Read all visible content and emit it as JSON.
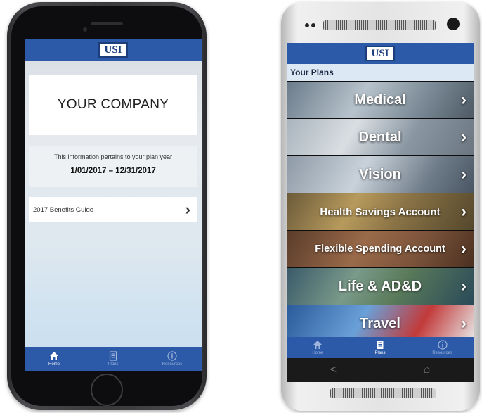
{
  "left_phone": {
    "logo": "USI",
    "company": "YOUR COMPANY",
    "plan_info": "This information pertains to your plan year",
    "plan_dates": "1/01/2017 – 12/31/2017",
    "guide_label": "2017 Benefits Guide",
    "tabs": [
      {
        "label": "Home",
        "icon": "home-icon",
        "active": true
      },
      {
        "label": "Plans",
        "icon": "document-icon",
        "active": false
      },
      {
        "label": "Resources",
        "icon": "info-icon",
        "active": false
      }
    ]
  },
  "right_phone": {
    "logo": "USI",
    "header": "Your Plans",
    "plans": [
      {
        "label": "Medical"
      },
      {
        "label": "Dental"
      },
      {
        "label": "Vision"
      },
      {
        "label": "Health Savings Account"
      },
      {
        "label": "Flexible Spending Account"
      },
      {
        "label": "Life & AD&D"
      },
      {
        "label": "Travel"
      }
    ],
    "tabs": [
      {
        "label": "Home",
        "icon": "home-icon",
        "active": false
      },
      {
        "label": "Plans",
        "icon": "document-icon",
        "active": true
      },
      {
        "label": "Resources",
        "icon": "info-icon",
        "active": false
      }
    ],
    "nav": {
      "back": "<",
      "home": "⌂"
    }
  },
  "colors": {
    "brand_blue": "#2c5aa8",
    "logo_border": "#1c3f7c",
    "header_bg": "#dde8f5"
  }
}
